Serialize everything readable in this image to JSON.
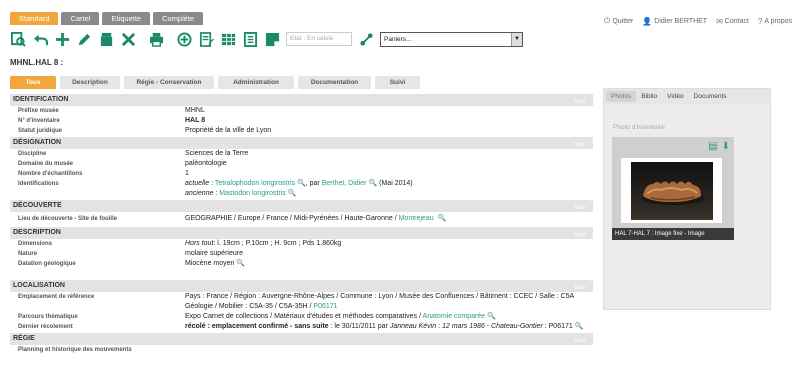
{
  "view_tabs": [
    "Standard",
    "Cartel",
    "Etiquette",
    "Complète"
  ],
  "top_links": {
    "quit": "Quitter",
    "user": "Didier BERTHET",
    "contact": "Contact",
    "about": "A propos"
  },
  "toolbar": {
    "state_placeholder": "Etat : En saisie",
    "panier_value": "Paniers..."
  },
  "record_title": "MHNL.HAL 8 :",
  "record_tabs": [
    "Tous",
    "Description",
    "Régie - Conservation",
    "Administration",
    "Documentation",
    "Suivi"
  ],
  "sections": {
    "identification": {
      "title": "IDENTIFICATION",
      "prefix_label": "Préfixe musée",
      "prefix": "MHNL",
      "inv_label": "N° d'inventaire",
      "inv": "HAL 8",
      "status_label": "Statut juridique",
      "status": "Propriété de la ville de Lyon"
    },
    "designation": {
      "title": "DÉSIGNATION",
      "discipline_label": "Discipline",
      "discipline": "Sciences de la Terre",
      "domain_label": "Domaine du musée",
      "domain": "paléontologie",
      "count_label": "Nombre d'échantillons",
      "count": "1",
      "ident_label": "Identifications",
      "ident_current_prefix": "actuelle",
      "ident_current_taxon": "Tetralophodon longirostris",
      "ident_by": ", par",
      "ident_author": "Berthet, Didier",
      "ident_date": "(Mai 2014)",
      "ident_old_prefix": "ancienne",
      "ident_old_taxon": "Mastodon longirostris"
    },
    "discovery": {
      "title": "DÉCOUVERTE",
      "place_label": "Lieu de découverte - Site de fouille",
      "place": "GEOGRAPHIE  /  Europe  /  France  /  Midi-Pyrénées  /  Haute-Garonne  /",
      "place_link": "Montrejeau"
    },
    "description": {
      "title": "DESCRIPTION",
      "dims_label": "Dimensions",
      "dims_prefix": "Hors tout",
      "dims": ": l. 19cm ; P.10cm ; H. 9cm ; Pds 1.860kg",
      "nature_label": "Nature",
      "nature": "molaire supérieure",
      "dating_label": "Datation géologique",
      "dating": "Miocène moyen"
    },
    "localisation": {
      "title": "LOCALISATION",
      "ref_label": "Emplacement de référence",
      "ref_line1": "Pays : France / Région : Auvergne-Rhône-Alpes / Commune : Lyon / Musée des Confluences / Bâtiment : CCEC / Salle : C5A",
      "ref_line2": "Géologie / Mobilier : C5A-35 / C5A-35H /",
      "ref_link": "P06171",
      "parcours_label": "Parcours thématique",
      "parcours": "Expo Carnet de collections / Matériaux d'études et méthodes comparatives /",
      "parcours_link": "Anatomie comparée",
      "last_label": "Dernier récolement",
      "last_bold": "récolé : emplacement confirmé - sans suite",
      "last_mid": " : le 30/11/2011 par",
      "last_it1": "Janneau Kévin",
      "last_mid2": " : ",
      "last_it2": "12 mars 1986",
      "last_mid3": " - ",
      "last_it3": "Chateau-Gontier",
      "last_end": " : P06171"
    },
    "regie": {
      "title": "RÉGIE",
      "planning_label": "Planning et historique des mouvements"
    }
  },
  "section_tag": "Haut",
  "right_panel": {
    "tabs": [
      "Photos",
      "Biblio",
      "Vidéo",
      "Documents"
    ],
    "label": "Photo d'inventaire",
    "caption": "HAL 7-HAL 7 : Image fixe - Image"
  },
  "colors": {
    "accent": "#f0a73c",
    "link": "#2a9a8a",
    "toolbar_icon": "#1a8a6a"
  }
}
